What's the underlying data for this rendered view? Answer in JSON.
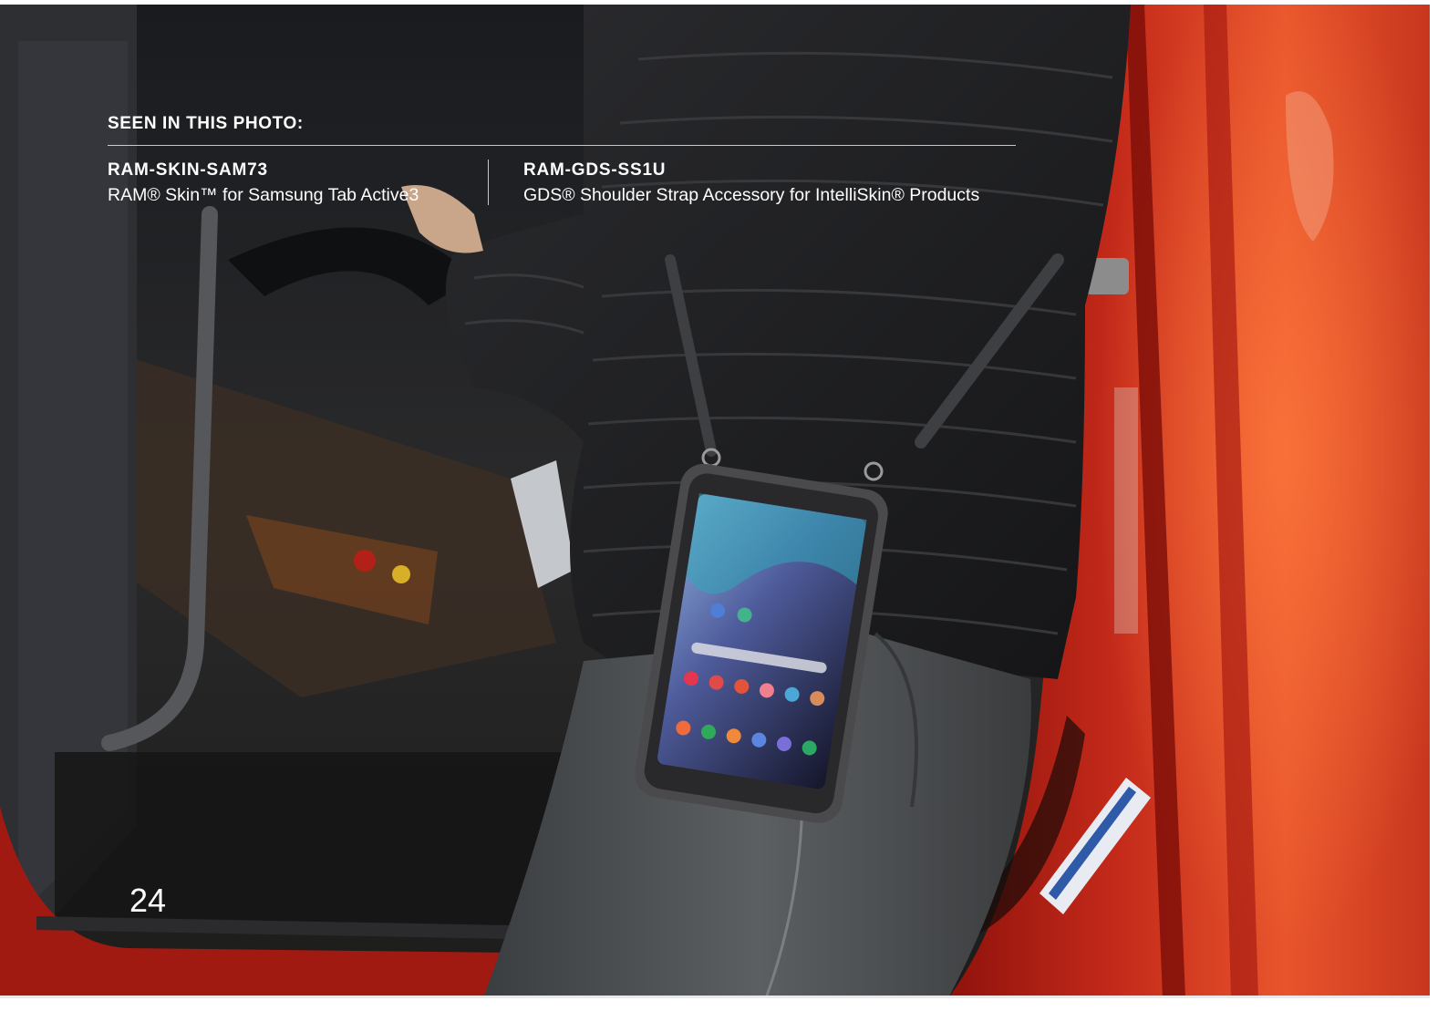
{
  "caption": {
    "heading": "SEEN IN THIS PHOTO:",
    "products": [
      {
        "sku": "RAM-SKIN-SAM73",
        "description": "RAM® Skin™ for Samsung Tab Active3"
      },
      {
        "sku": "RAM-GDS-SS1U",
        "description": "GDS® Shoulder Strap Accessory for IntelliSkin® Products"
      }
    ]
  },
  "page_number": "24",
  "colors": {
    "truck_red": "#c7261a",
    "jacket": "#1c1c1e",
    "jeans": "#4e5154",
    "text": "#ffffff"
  }
}
